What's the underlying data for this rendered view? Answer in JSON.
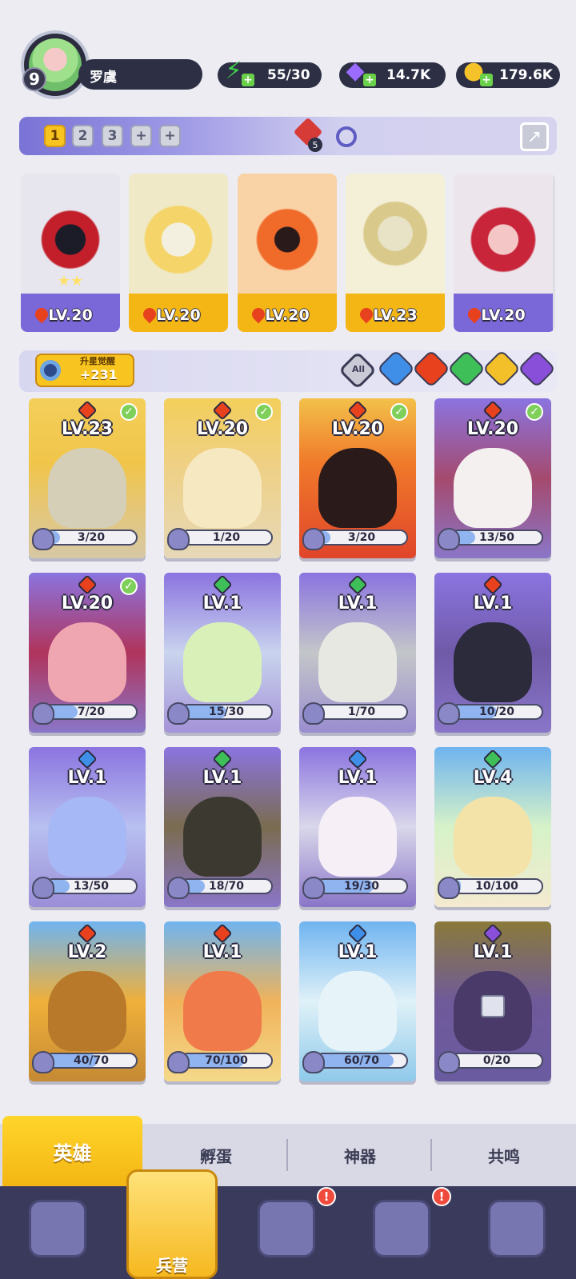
{
  "player": {
    "level": "9",
    "name": "罗虞"
  },
  "resources": {
    "energy": "55/30",
    "gems": "14.7K",
    "coins": "179.6K",
    "plus": "+"
  },
  "team": {
    "tabs": [
      "1",
      "2",
      "3",
      "+",
      "+"
    ],
    "active_tab": "1",
    "gem_count": "5",
    "cards": [
      {
        "level": "LV.20",
        "stars": "★★"
      },
      {
        "level": "LV.20",
        "stars": ""
      },
      {
        "level": "LV.20",
        "stars": ""
      },
      {
        "level": "LV.23",
        "stars": ""
      },
      {
        "level": "LV.20",
        "stars": ""
      }
    ]
  },
  "awaken": {
    "title": "升星觉醒",
    "value": "+231"
  },
  "filters": {
    "all": "All"
  },
  "heroes": [
    {
      "level": "LV.23",
      "progress": "3/20",
      "fraction": 0.15,
      "element": "fire",
      "checked": true
    },
    {
      "level": "LV.20",
      "progress": "1/20",
      "fraction": 0.05,
      "element": "fire",
      "checked": true
    },
    {
      "level": "LV.20",
      "progress": "3/20",
      "fraction": 0.15,
      "element": "fire",
      "checked": true
    },
    {
      "level": "LV.20",
      "progress": "13/50",
      "fraction": 0.26,
      "element": "fire",
      "checked": true
    },
    {
      "level": "LV.20",
      "progress": "7/20",
      "fraction": 0.35,
      "element": "fire",
      "checked": true
    },
    {
      "level": "LV.1",
      "progress": "15/30",
      "fraction": 0.5,
      "element": "nature",
      "checked": false
    },
    {
      "level": "LV.1",
      "progress": "1/70",
      "fraction": 0.014,
      "element": "nature",
      "checked": false
    },
    {
      "level": "LV.1",
      "progress": "10/20",
      "fraction": 0.5,
      "element": "fire",
      "checked": false
    },
    {
      "level": "LV.1",
      "progress": "13/50",
      "fraction": 0.26,
      "element": "water",
      "checked": false
    },
    {
      "level": "LV.1",
      "progress": "18/70",
      "fraction": 0.257,
      "element": "nature",
      "checked": false
    },
    {
      "level": "LV.1",
      "progress": "19/30",
      "fraction": 0.633,
      "element": "water",
      "checked": false
    },
    {
      "level": "LV.4",
      "progress": "10/100",
      "fraction": 0.1,
      "element": "nature",
      "checked": false
    },
    {
      "level": "LV.2",
      "progress": "40/70",
      "fraction": 0.571,
      "element": "fire",
      "checked": false
    },
    {
      "level": "LV.1",
      "progress": "70/100",
      "fraction": 0.7,
      "element": "fire",
      "checked": false
    },
    {
      "level": "LV.1",
      "progress": "60/70",
      "fraction": 0.857,
      "element": "water",
      "checked": false
    },
    {
      "level": "LV.1",
      "progress": "0/20",
      "fraction": 0,
      "element": "dark",
      "checked": false,
      "locked": true
    }
  ],
  "tabs": [
    "英雄",
    "孵蛋",
    "神器",
    "共鸣"
  ],
  "nav": {
    "active_label": "兵营",
    "alert": "!"
  },
  "colors": {
    "fire": "#e8411e",
    "nature": "#3fbf58",
    "water": "#3f8fe8",
    "dark": "#8a4fd8",
    "gold": "#f4b614",
    "navbar": "#3a3b5c"
  }
}
